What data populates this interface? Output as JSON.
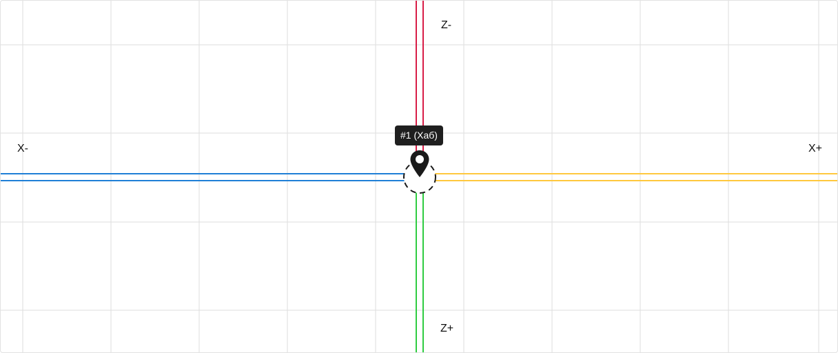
{
  "map": {
    "axes": {
      "z_minus": "Z-",
      "z_plus": "Z+",
      "x_minus": "X-",
      "x_plus": "X+"
    },
    "hub": {
      "tooltip": "#1 (Хаб)",
      "icon": "map-pin-icon"
    },
    "colors": {
      "z_minus_road": "#d81b45",
      "z_plus_road": "#2ecc40",
      "x_minus_road": "#1e7fd6",
      "x_plus_road": "#ffc83d",
      "grid": "#dddddd",
      "tooltip_bg": "#1f1f1f"
    }
  }
}
